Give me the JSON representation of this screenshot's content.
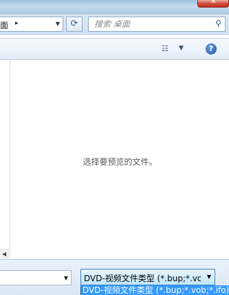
{
  "address": {
    "crumb": "面",
    "separator": "▸"
  },
  "search": {
    "placeholder": "搜索 桌面"
  },
  "preview": {
    "message": "选择要预览的文件。"
  },
  "filetype": {
    "selected": "DVD-视频文件类型 (*.bup;*.vob",
    "options": [
      "DVD-视频文件类型 (*.bup;*.vob;*.ifo)"
    ]
  },
  "toolbar": {
    "help": "?"
  },
  "colors": {
    "selection": "#3399ff",
    "close": "#c2311f",
    "chrome": "#dce9f6"
  },
  "icons": {
    "refresh": "refresh-icon",
    "search": "search-icon",
    "views": "views-icon",
    "help": "help-icon",
    "close": "close-icon"
  }
}
